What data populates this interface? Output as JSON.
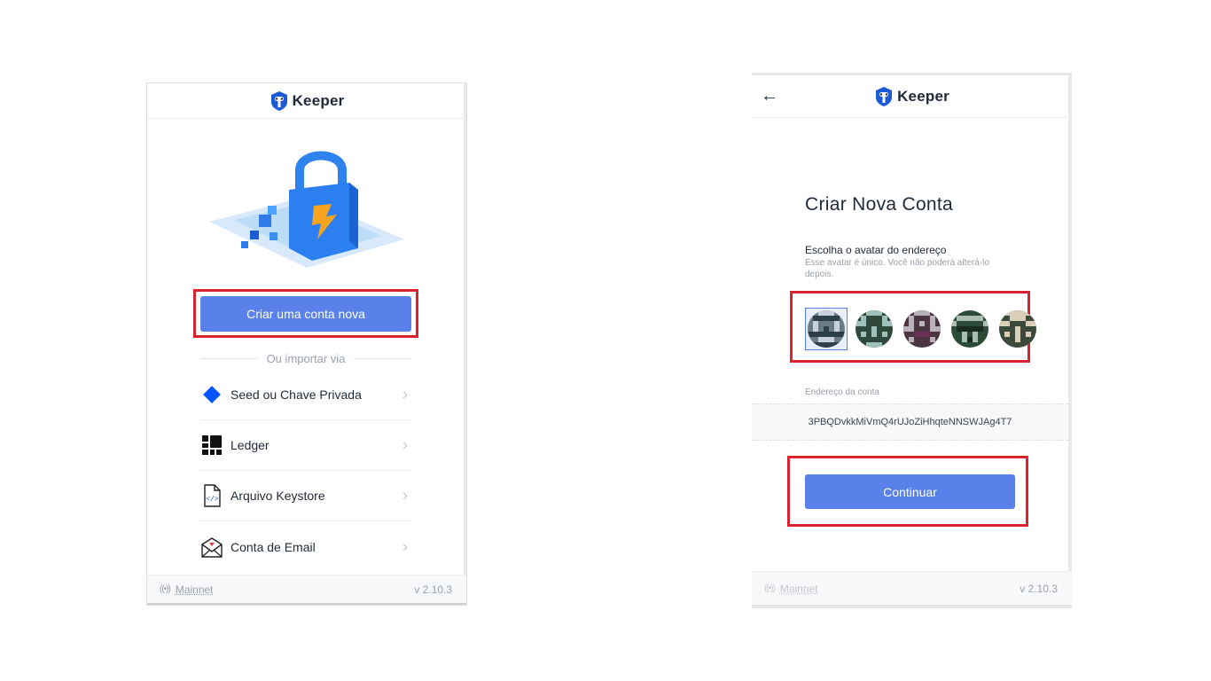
{
  "left": {
    "logo_text": "Keeper",
    "create_button_label": "Criar uma conta nova",
    "divider_text": "Ou importar via",
    "import_items": [
      {
        "label": "Seed ou Chave Privada",
        "icon": "diamond-icon"
      },
      {
        "label": "Ledger",
        "icon": "ledger-icon"
      },
      {
        "label": "Arquivo Keystore",
        "icon": "keystore-file-icon"
      },
      {
        "label": "Conta de Email",
        "icon": "email-icon"
      }
    ],
    "network": "Mainnet",
    "version": "v 2.10.3"
  },
  "right": {
    "logo_text": "Keeper",
    "back_icon": "←",
    "title": "Criar Nova Conta",
    "avatar_label": "Escolha o avatar do endereço",
    "avatar_description": "Esse avatar é único. Você não poderá alterá-lo depois.",
    "address_label": "Endereço da conta",
    "address": "3PBQDvkkMiVmQ4rUJoZiHhqteNNSWJAg4T7",
    "continue_button_label": "Continuar",
    "network": "Mainnet",
    "version": "v 2.10.3"
  },
  "colors": {
    "accent": "#5a81ea",
    "highlight": "#d9232e",
    "muted": "#9aa1ab"
  }
}
